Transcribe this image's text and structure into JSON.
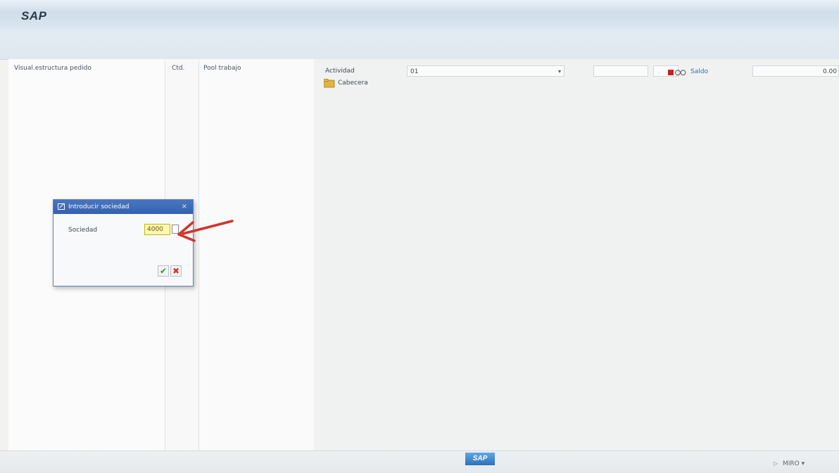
{
  "app": {
    "title": "SAP"
  },
  "columns": {
    "tree_header": "Visual.estructura pedido",
    "qty_header": "Ctd.",
    "pool_header": "Pool trabajo"
  },
  "main": {
    "activity_label": "Actividad",
    "activity_value": "01",
    "header_label": "Cabecera",
    "saldo_link": "Saldo",
    "saldo_value": "0.00"
  },
  "dialog": {
    "title": "Introducir sociedad",
    "close": "×",
    "sociedad_label": "Sociedad",
    "sociedad_value": "4000"
  },
  "statusbar": {
    "logo": "SAP",
    "tcode": "MIRO"
  },
  "colors": {
    "dialog_title_bg": "#3361b0",
    "input_highlight": "#fff7b0",
    "arrow": "#d0352b",
    "link": "#2f6db5"
  },
  "icons": [
    "folder-icon",
    "dialog-icon",
    "close-icon",
    "f4-help-icon",
    "check-icon",
    "cancel-icon",
    "status-light-icon",
    "dropdown-arrow-icon"
  ]
}
